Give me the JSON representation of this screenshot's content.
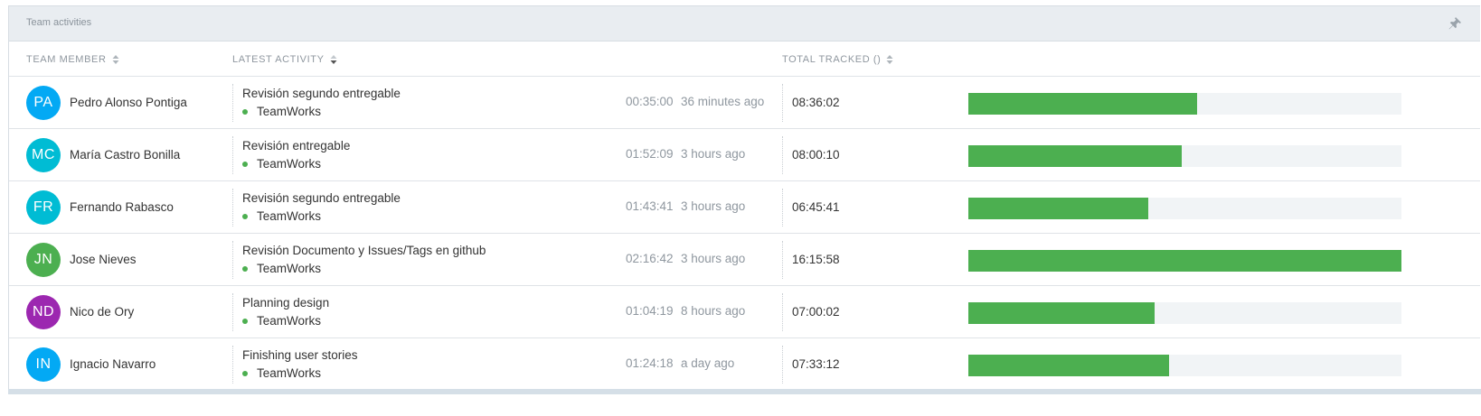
{
  "panel": {
    "title": "Team activities",
    "pin_icon": "pin-icon"
  },
  "headers": {
    "member": "TEAM MEMBER",
    "activity": "LATEST ACTIVITY",
    "total": "TOTAL TRACKED ()"
  },
  "colors": {
    "bar": "#4caf50",
    "bar_track": "#f1f4f6"
  },
  "rows": [
    {
      "initials": "PA",
      "avatar_color": "#03a9f4",
      "name": "Pedro Alonso Pontiga",
      "activity": "Revisión segundo entregable",
      "project": "TeamWorks",
      "duration": "00:35:00",
      "ago": "36 minutes ago",
      "total": "08:36:02",
      "progress": 0.529
    },
    {
      "initials": "MC",
      "avatar_color": "#00bcd4",
      "name": "María Castro Bonilla",
      "activity": "Revisión entregable",
      "project": "TeamWorks",
      "duration": "01:52:09",
      "ago": "3 hours ago",
      "total": "08:00:10",
      "progress": 0.492
    },
    {
      "initials": "FR",
      "avatar_color": "#00bcd4",
      "name": "Fernando Rabasco",
      "activity": "Revisión segundo entregable",
      "project": "TeamWorks",
      "duration": "01:43:41",
      "ago": "3 hours ago",
      "total": "06:45:41",
      "progress": 0.416
    },
    {
      "initials": "JN",
      "avatar_color": "#4caf50",
      "name": "Jose Nieves",
      "activity": "Revisión Documento y Issues/Tags en github",
      "project": "TeamWorks",
      "duration": "02:16:42",
      "ago": "3 hours ago",
      "total": "16:15:58",
      "progress": 1.0
    },
    {
      "initials": "ND",
      "avatar_color": "#9c27b0",
      "name": "Nico de Ory",
      "activity": "Planning design",
      "project": "TeamWorks",
      "duration": "01:04:19",
      "ago": "8 hours ago",
      "total": "07:00:02",
      "progress": 0.43
    },
    {
      "initials": "IN",
      "avatar_color": "#03a9f4",
      "name": "Ignacio Navarro",
      "activity": "Finishing user stories",
      "project": "TeamWorks",
      "duration": "01:24:18",
      "ago": "a day ago",
      "total": "07:33:12",
      "progress": 0.464
    }
  ]
}
